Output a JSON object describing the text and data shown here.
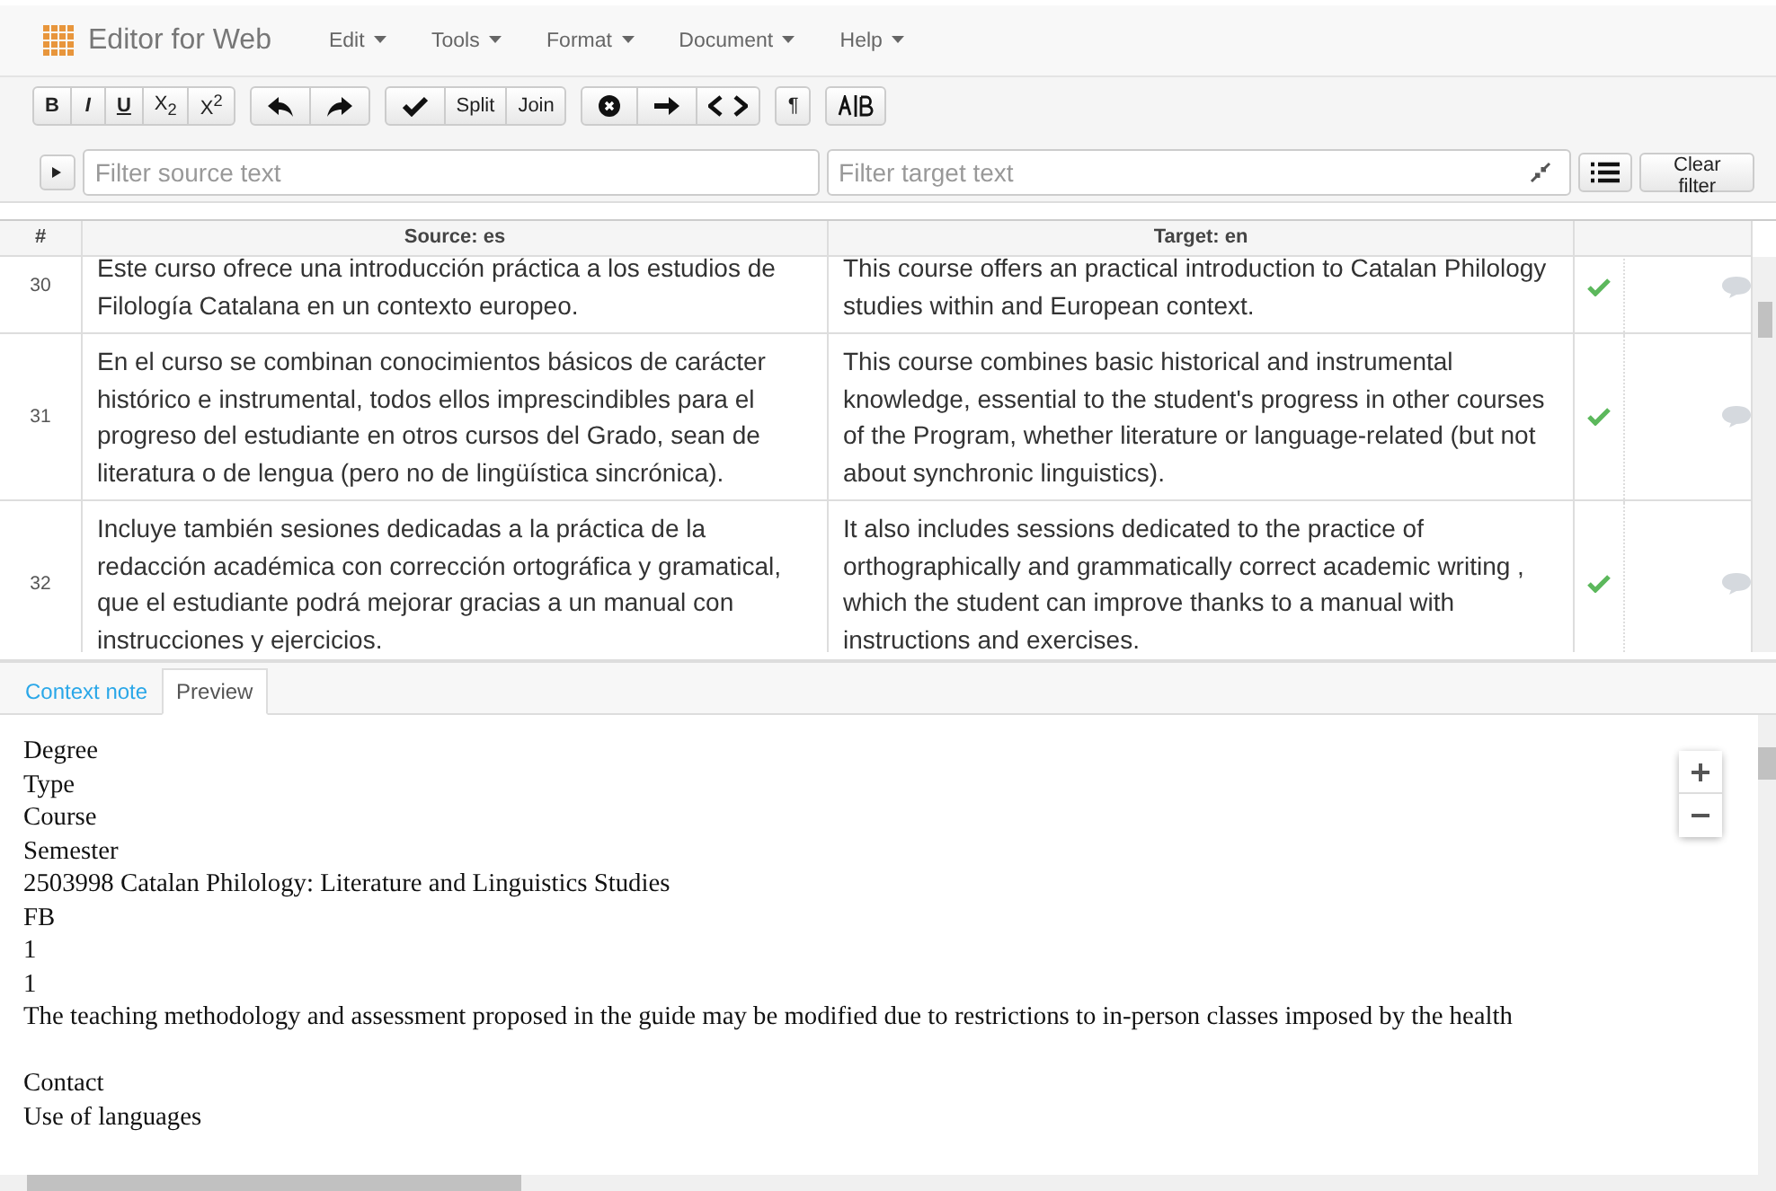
{
  "app": {
    "title": "Editor for Web"
  },
  "menu": [
    {
      "label": "Edit"
    },
    {
      "label": "Tools"
    },
    {
      "label": "Format"
    },
    {
      "label": "Document"
    },
    {
      "label": "Help"
    }
  ],
  "toolbar": [
    [
      {
        "kind": "bold",
        "label": "B"
      },
      {
        "kind": "italic",
        "label": "I"
      },
      {
        "kind": "underline",
        "label": "U"
      },
      {
        "kind": "sub",
        "label": "X$_{2}$"
      },
      {
        "kind": "sup",
        "label": "X$^{2}$"
      }
    ],
    [
      {
        "kind": "undo"
      },
      {
        "kind": "redo"
      }
    ],
    [
      {
        "kind": "confirm"
      },
      {
        "kind": "text",
        "label": "Split"
      },
      {
        "kind": "text",
        "label": "Join"
      }
    ],
    [
      {
        "kind": "clear"
      },
      {
        "kind": "copy"
      },
      {
        "kind": "tags"
      }
    ],
    [
      {
        "kind": "text",
        "label": "¶"
      }
    ],
    [
      {
        "kind": "spell"
      }
    ]
  ],
  "filters": {
    "source_placeholder": "Filter source text",
    "target_placeholder": "Filter target text",
    "clear": "Clear filter"
  },
  "table": {
    "columns": [
      "#",
      "Source: es",
      "Target: en"
    ],
    "rows": [
      {
        "num": "30",
        "source": "Este curso ofrece una introducción práctica a los estudios de Filología Catalana en un contexto europeo.",
        "target": "This course offers an practical introduction to Catalan Philology studies within and European context.",
        "confirmed": true
      },
      {
        "num": "31",
        "source": "En el curso se combinan conocimientos básicos de carácter histórico e instrumental, todos ellos imprescindibles para el progreso del estudiante en otros cursos del Grado, sean de literatura o de lengua (pero no de lingüística sincrónica).",
        "target": "This course combines basic historical and instrumental knowledge, essential to the student's progress in other courses of the Program, whether literature or language-related (but not about synchronic linguistics).",
        "confirmed": true
      },
      {
        "num": "32",
        "source": "Incluye también sesiones dedicadas a la práctica de la redacción académica con corrección ortográfica y gramatical, que el estudiante podrá mejorar gracias a un manual con instrucciones y ejercicios.",
        "target": "It also includes sessions dedicated to the practice of orthographically and grammatically correct academic writing , which the student can improve thanks to a manual with instructions and exercises.",
        "confirmed": true
      }
    ]
  },
  "bottom_tabs": [
    {
      "label": "Context note",
      "selected": false
    },
    {
      "label": "Preview",
      "selected": true
    }
  ],
  "preview": [
    [
      "Degree",
      "Type",
      "Course",
      "Semester",
      "2503998 Catalan Philology: Literature and Linguistics Studies",
      "FB",
      "1",
      "1",
      "The teaching methodology and assessment proposed in the guide may be modified due to restrictions to in-person classes imposed by the health"
    ],
    [
      "Contact",
      "Use of languages"
    ]
  ]
}
